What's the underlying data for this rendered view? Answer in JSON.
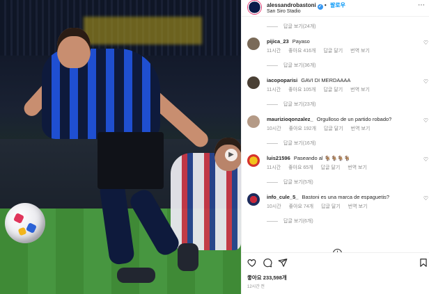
{
  "post": {
    "username": "alessandrobastoni",
    "follow_label": "팔로우",
    "location": "San Siro Stadio",
    "more_icon": "more-horizontal-icon"
  },
  "photo": {
    "alt_icon": "next-photo-arrow-icon"
  },
  "comments": [
    {
      "replies_label": "답글 보기(24개)"
    },
    {
      "user": "pijica_23",
      "text": "Payaso",
      "time": "11시간",
      "likes": "좋아요 416개",
      "reply": "답글 달기",
      "translate": "번역 보기",
      "avatar_color": "#7a6a58",
      "replies_label": "답글 보기(36개)"
    },
    {
      "user": "iacopoparisi",
      "text": "GAVI DI MERDAAAA",
      "time": "11시간",
      "likes": "좋아요 105개",
      "reply": "답글 달기",
      "translate": "번역 보기",
      "avatar_color": "#4a4035",
      "replies_label": "답글 보기(23개)"
    },
    {
      "user": "maurizioqonzalez_",
      "text": "Orgulloso de un partido robado?",
      "time": "10시간",
      "likes": "좋아요 192개",
      "reply": "답글 달기",
      "translate": "번역 보기",
      "avatar_color": "#b49a86",
      "replies_label": "답글 보기(16개)"
    },
    {
      "user": "luis21596",
      "text": "Paseando al 🐐🐐🐐🐐",
      "time": "11시간",
      "likes": "좋아요 65개",
      "reply": "답글 달기",
      "translate": "번역 보기",
      "avatar_color": "#d6322c",
      "replies_label": "답글 보기(5개)"
    },
    {
      "user": "info_cule_5_",
      "text": "Bastoni es una marca de espaguetis?",
      "time": "10시간",
      "likes": "좋아요 74개",
      "reply": "답글 달기",
      "translate": "번역 보기",
      "avatar_color": "#1d2b5c",
      "replies_label": "답글 보기(6개)"
    }
  ],
  "footer": {
    "likes_label": "좋아요 233,598개",
    "time_label": "12시간 전"
  },
  "colors": {
    "accent": "#0095f6",
    "verified": "#3897f0",
    "muted_text": "#8e8e8e"
  }
}
